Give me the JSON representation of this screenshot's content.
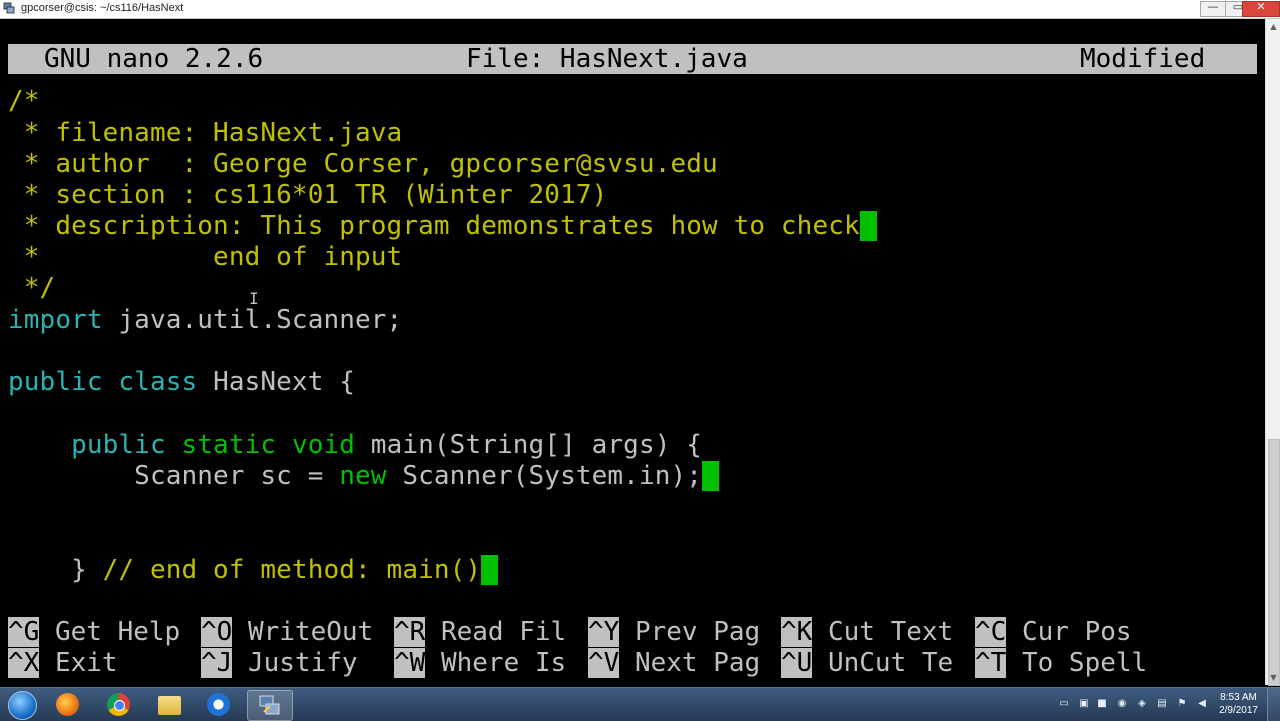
{
  "window": {
    "title": "gpcorser@csis: ~/cs116/HasNext",
    "minimize_glyph": "—",
    "maximize_glyph": "▭",
    "close_glyph": "✕"
  },
  "nano": {
    "header": {
      "app": "GNU nano 2.2.6",
      "file": "File: HasNext.java",
      "status": "Modified"
    },
    "code": {
      "l1": "/*",
      "l2": " * filename: HasNext.java",
      "l3": " * author  : George Corser, gpcorser@svsu.edu",
      "l4": " * section : cs116*01 TR (Winter 2017)",
      "l5": " * description: This program demonstrates how to check",
      "l6": " *           end of input",
      "l7": " */",
      "l8_kw": "import",
      "l8_rest": " java.util.Scanner;",
      "l10_kw1": "public",
      "l10_sp": " ",
      "l10_kw2": "class",
      "l10_rest": " HasNext {",
      "l12_indent": "    ",
      "l12_kw1": "public",
      "l12_sp1": " ",
      "l12_kw2": "static",
      "l12_sp2": " ",
      "l12_kw3": "void",
      "l12_rest": " main(String[] args) {",
      "l13_pre": "        Scanner sc = ",
      "l13_kw": "new",
      "l13_rest": " Scanner(System.in);",
      "l16_pre": "    } ",
      "l16_comment": "// end of method: main()"
    },
    "shortcuts": [
      {
        "key": "^G",
        "label": " Get Help"
      },
      {
        "key": "^O",
        "label": " WriteOut"
      },
      {
        "key": "^R",
        "label": " Read Fil"
      },
      {
        "key": "^Y",
        "label": " Prev Pag"
      },
      {
        "key": "^K",
        "label": " Cut Text"
      },
      {
        "key": "^C",
        "label": " Cur Pos"
      },
      {
        "key": "^X",
        "label": " Exit"
      },
      {
        "key": "^J",
        "label": " Justify"
      },
      {
        "key": "^W",
        "label": " Where Is"
      },
      {
        "key": "^V",
        "label": " Next Pag"
      },
      {
        "key": "^U",
        "label": " UnCut Te"
      },
      {
        "key": "^T",
        "label": " To Spell"
      }
    ]
  },
  "colors": {
    "comment": "#c0c000",
    "keyword": "#2db2b2",
    "cursor": "#00c000",
    "text": "#c0c0c0"
  },
  "taskbar": {
    "apps": [
      "start-orb",
      "firefox-icon",
      "chrome-icon",
      "file-explorer-icon",
      "teamviewer-icon",
      "putty-icon"
    ],
    "clock": {
      "time": "8:53 AM",
      "date": "2/9/2017"
    }
  },
  "scrollbar": {
    "up_glyph": "▲",
    "down_glyph": "▼"
  }
}
